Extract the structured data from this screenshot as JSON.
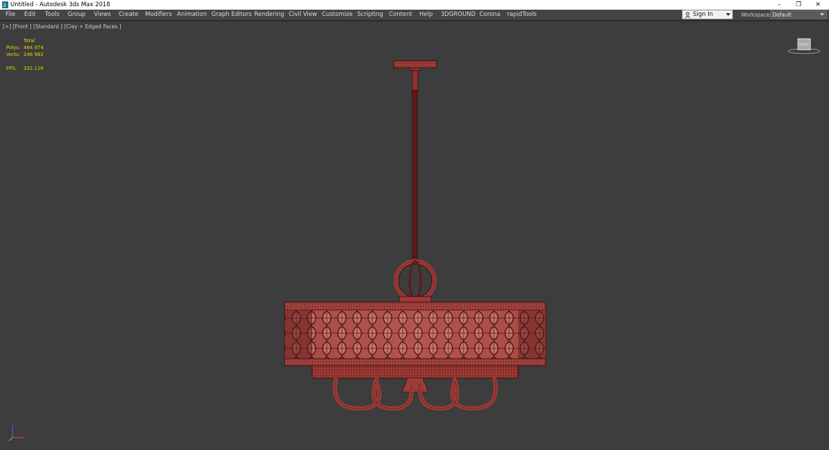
{
  "window": {
    "title": "Untitled - Autodesk 3ds Max 2018",
    "controls": {
      "minimize": "–",
      "restore": "❐",
      "close": "✕"
    }
  },
  "menu": {
    "items": [
      {
        "label": "File"
      },
      {
        "label": "Edit"
      },
      {
        "label": "Tools"
      },
      {
        "label": "Group"
      },
      {
        "label": "Views"
      },
      {
        "label": "Create"
      },
      {
        "label": "Modifiers"
      },
      {
        "label": "Animation"
      },
      {
        "label": "Graph Editors"
      },
      {
        "label": "Rendering"
      },
      {
        "label": "Civil View"
      },
      {
        "label": "Customize"
      },
      {
        "label": "Scripting"
      },
      {
        "label": "Content"
      },
      {
        "label": "Help"
      },
      {
        "label": "3DGROUND"
      },
      {
        "label": "Corona"
      },
      {
        "label": "rapidTools"
      }
    ],
    "sign_in": "Sign In",
    "workspaces_label": "Workspaces:",
    "workspaces_value": "Default"
  },
  "viewport": {
    "label": "[+] [Front ] [Standard ] [Clay + Edged Faces ]",
    "stats": {
      "header": "Total",
      "polys_label": "Polys:",
      "polys_value": "464 974",
      "verts_label": "Verts:",
      "verts_value": "246 982",
      "fps_label": "FPS:",
      "fps_value": "332,116"
    },
    "viewcube_label": "FRONT"
  },
  "colors": {
    "viewport_bg": "#3d3d3d",
    "model_fill": "#9e3a36",
    "model_wire": "#3a0c0b",
    "stats_text": "#e8d400"
  },
  "icons": {
    "app": "3ds-max-icon",
    "user": "user-icon",
    "axis": "axis-tripod-icon"
  }
}
